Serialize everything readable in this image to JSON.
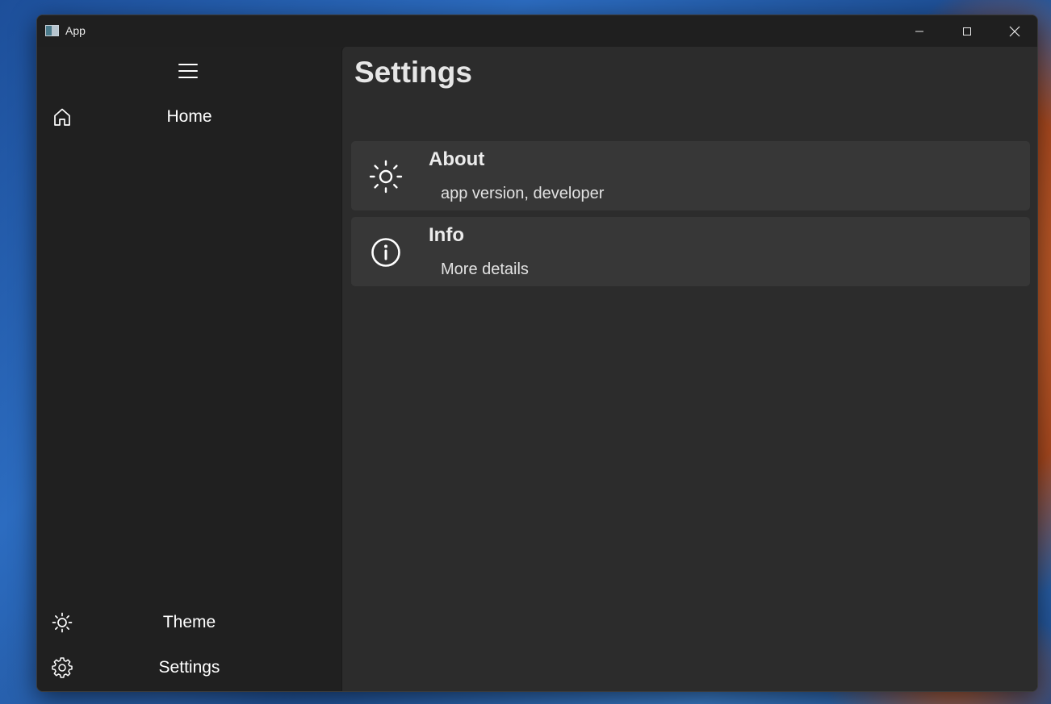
{
  "window": {
    "title": "App"
  },
  "nav": {
    "top_items": [
      {
        "label": "Home",
        "icon": "home-icon"
      }
    ],
    "bottom_items": [
      {
        "label": "Theme",
        "icon": "sun-icon"
      },
      {
        "label": "Settings",
        "icon": "gear-icon"
      }
    ]
  },
  "page": {
    "title": "Settings",
    "cards": [
      {
        "title": "About",
        "subtitle": "app version, developer",
        "icon": "sun-icon"
      },
      {
        "title": "Info",
        "subtitle": "More details",
        "icon": "info-icon"
      }
    ]
  },
  "colors": {
    "sidebar_bg": "#202020",
    "content_bg": "#2c2c2c",
    "card_bg": "#373737"
  }
}
